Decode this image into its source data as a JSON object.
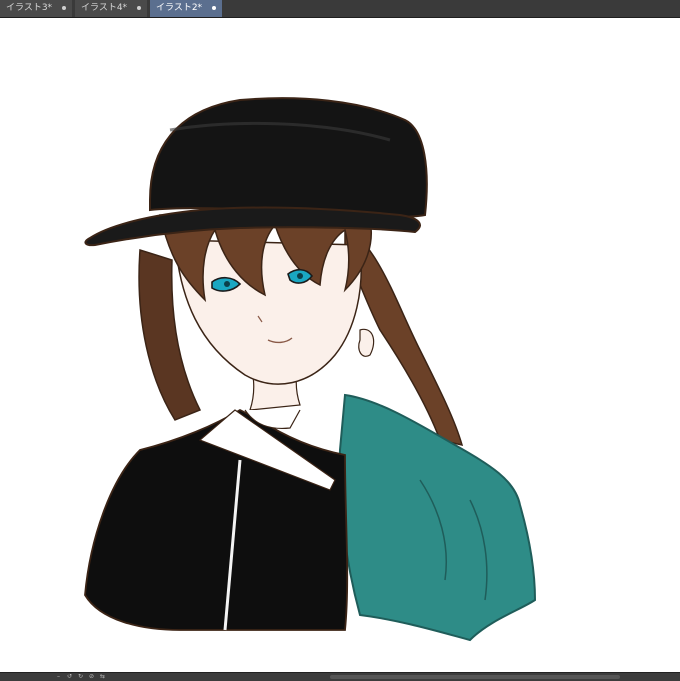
{
  "tabs": [
    {
      "label": "イラスト3*",
      "active": false
    },
    {
      "label": "イラスト4*",
      "active": false
    },
    {
      "label": "イラスト2*",
      "active": true
    }
  ],
  "canvas": {
    "artwork": "anime-character-sketch",
    "colors": {
      "hair": "#5a3622",
      "hat": "#141414",
      "coat": "#0e0e0e",
      "cape": "#2e8c87",
      "eyes": "#1aa7c2",
      "skin": "#fbf0ea",
      "outline": "#3b2416"
    }
  },
  "statusbar": {
    "icons": [
      "zoom-out-icon",
      "rotate-left-icon",
      "rotate-right-icon",
      "reset-rotation-icon",
      "flip-icon"
    ]
  }
}
